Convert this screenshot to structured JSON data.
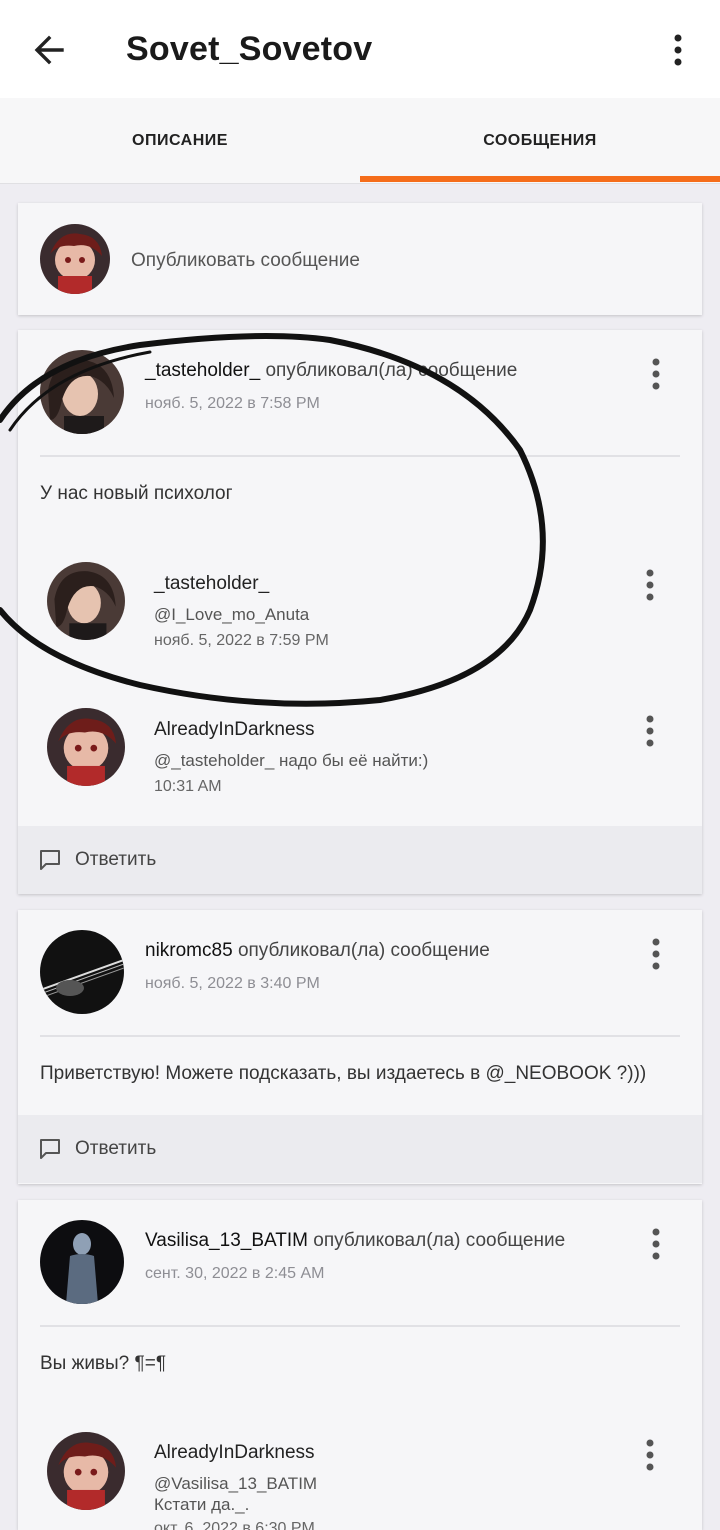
{
  "appbar": {
    "title": "Sovet_Sovetov"
  },
  "tabs": [
    {
      "label": "ОПИСАНИЕ"
    },
    {
      "label": "СООБЩЕНИЯ"
    }
  ],
  "composer": {
    "placeholder": "Опубликовать сообщение"
  },
  "posts": [
    {
      "author": "_tasteholder_",
      "verb": "опубликовал(ла) сообщение",
      "date": "нояб. 5, 2022 в 7:58 PM",
      "body": "У нас новый психолог",
      "replies": [
        {
          "author": "_tasteholder_",
          "lines": [
            "@I_Love_mo_Anuta"
          ],
          "time": "нояб. 5, 2022 в 7:59 PM"
        },
        {
          "author": "AlreadyInDarkness",
          "lines": [
            "@_tasteholder_  надо бы её найти:)"
          ],
          "time": "10:31 AM"
        }
      ],
      "reply_label": "Ответить"
    },
    {
      "author": "nikromc85",
      "verb": "опубликовал(ла) сообщение",
      "date": "нояб. 5, 2022 в 3:40 PM",
      "body": "Приветствую! Можете подсказать, вы издаетесь в @_NEOBOOK ?)))",
      "reply_label": "Ответить"
    },
    {
      "author": "Vasilisa_13_BATIM",
      "verb": "опубликовал(ла) сообщение",
      "date": "сент. 30, 2022 в 2:45 AM",
      "body": "Вы живы? ¶=¶",
      "replies": [
        {
          "author": "AlreadyInDarkness",
          "lines": [
            "@Vasilisa_13_BATIM",
            "Кстати да._."
          ],
          "time": "окт. 6, 2022 в 6:30 PM"
        }
      ]
    }
  ],
  "colors": {
    "accent": "#f56d1b",
    "background": "#eeedf2",
    "card": "#f6f6f8"
  },
  "icons": [
    "back-arrow-icon",
    "more-vert-icon",
    "comment-icon"
  ]
}
